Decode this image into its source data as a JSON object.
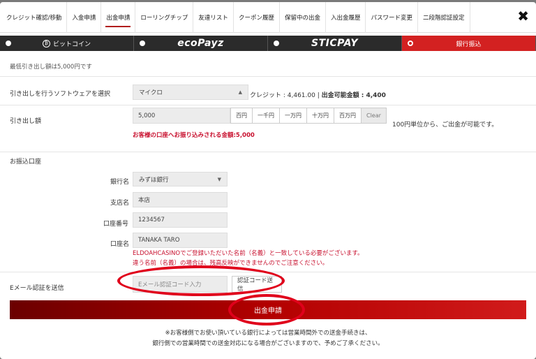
{
  "tabs": [
    {
      "label": "クレジット確認/移動"
    },
    {
      "label": "入金申請"
    },
    {
      "label": "出金申請"
    },
    {
      "label": "ローリングチップ"
    },
    {
      "label": "友達リスト"
    },
    {
      "label": "クーポン履歴"
    },
    {
      "label": "保留中の出金"
    },
    {
      "label": "入出金履歴"
    },
    {
      "label": "パスワード変更"
    },
    {
      "label": "二段階認証設定"
    }
  ],
  "close_symbol": "✖",
  "payment_methods": [
    {
      "label": "ビットコイン",
      "icon": "bitcoin-icon",
      "icon_glyph": "₿"
    },
    {
      "label": "ecoPayz"
    },
    {
      "label": "STICPAY"
    },
    {
      "label": "銀行振込"
    }
  ],
  "min_note": "最低引き出し額は5,000円です",
  "software": {
    "label": "引き出しを行うソフトウェアを選択",
    "selected": "マイクロ",
    "credit_prefix": "クレジット : 4,461.00 | ",
    "available_label": "出金可能金額 : 4,400"
  },
  "amount": {
    "label": "引き出し額",
    "value": "5,000",
    "buttons": [
      "百円",
      "一千円",
      "一万円",
      "十万円",
      "百万円",
      "Clear"
    ],
    "unit_note": "100円単位から、ご出金が可能です。",
    "transfer_label": "お客様の口座へお振り込みされる金額:",
    "transfer_value": "5,000"
  },
  "bank": {
    "section_label": "お振込口座",
    "bank_name_label": "銀行名",
    "bank_name_value": "みずほ銀行",
    "branch_label": "支店名",
    "branch_value": "本店",
    "account_no_label": "口座番号",
    "account_no_value": "1234567",
    "account_name_label": "口座名",
    "account_name_value": "TANAKA TARO",
    "warning_line1": "ELDOAHCASINOでご登録いただいた名前（名義）と一致している必要がございます。",
    "warning_line2": "違う名前（名義）の場合は、残高反映ができませんのでご注意ください。"
  },
  "email_auth": {
    "label": "Eメール認証を送信",
    "placeholder": "Eメール認証コード入力",
    "send_button": "認証コード送信"
  },
  "submit_label": "出金申請",
  "footer": {
    "line1": "※お客様側でお使い頂いている銀行によっては営業時間外での送金手続きは、",
    "line2": "銀行側での営業時間での送金対応になる場合がございますので、予めご了承ください。"
  },
  "colors": {
    "accent": "#d32121",
    "dark": "#2b2b2b",
    "annotation": "#e0001b"
  }
}
